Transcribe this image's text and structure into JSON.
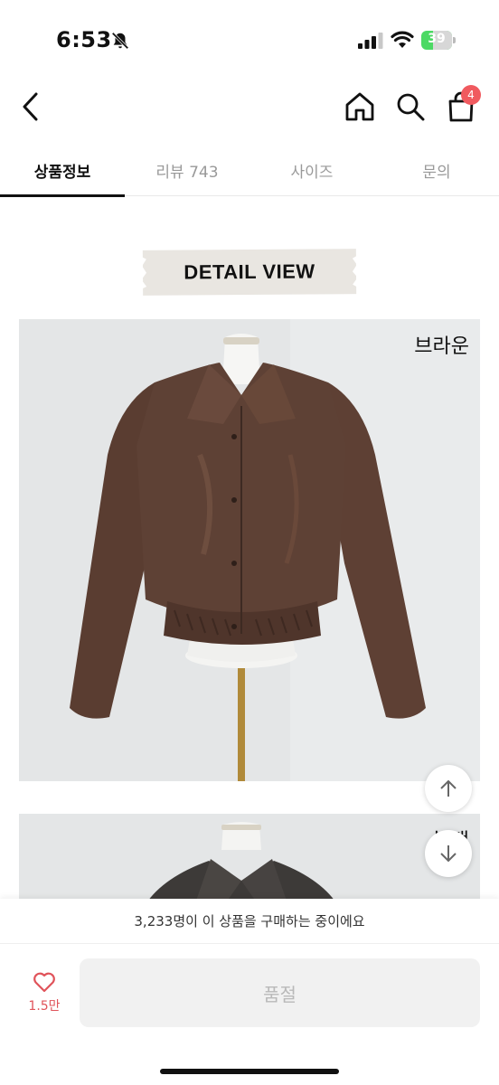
{
  "status_bar": {
    "time": "6:53",
    "battery_percent": "39",
    "battery_level": 0.39,
    "icons": [
      "bell-off-icon",
      "signal-icon",
      "wifi-icon",
      "battery-icon"
    ]
  },
  "header": {
    "icons": [
      "back-icon",
      "home-icon",
      "search-icon",
      "cart-icon"
    ],
    "cart_count": "4"
  },
  "tabs": [
    {
      "label": "상품정보",
      "active": true
    },
    {
      "label": "리뷰 743",
      "active": false
    },
    {
      "label": "사이즈",
      "active": false
    },
    {
      "label": "문의",
      "active": false
    }
  ],
  "content": {
    "banner_title": "DETAIL VIEW",
    "photo_1_label": "브라운",
    "photo_2_label": "블랙"
  },
  "bottom": {
    "buying_notice": "3,233명이 이 상품을 구매하는 중이에요",
    "like_count": "1.5만",
    "soldout_label": "품절"
  },
  "colors": {
    "accent_red": "#e0535a",
    "badge_red": "#f05a5f",
    "jacket_brown": "#5e4135",
    "jacket_black": "#3d3a38"
  }
}
